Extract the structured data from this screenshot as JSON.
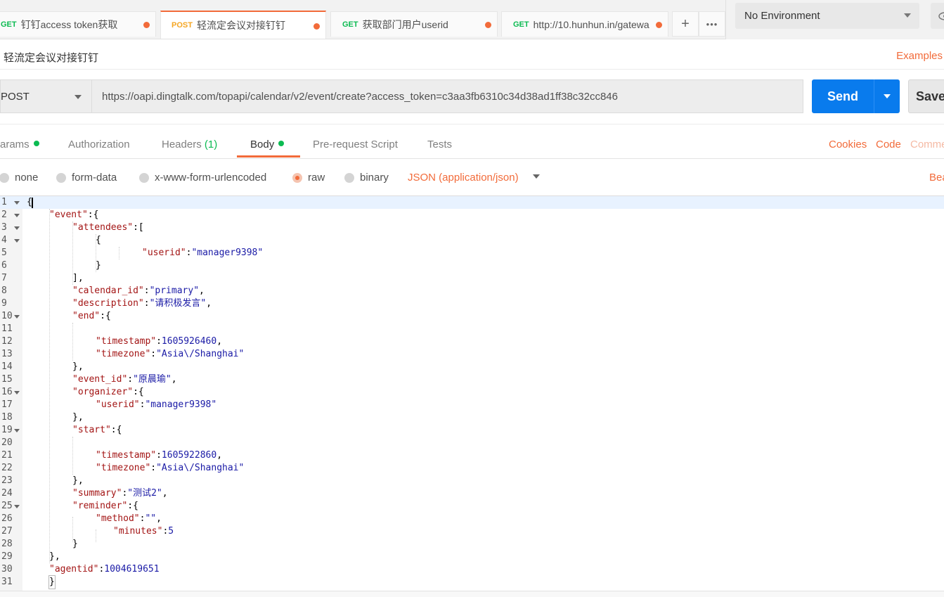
{
  "tabs": [
    {
      "method": "GET",
      "title": "钉钉access token获取"
    },
    {
      "method": "POST",
      "title": "轻流定会议对接钉钉"
    },
    {
      "method": "GET",
      "title": "获取部门用户userid"
    },
    {
      "method": "GET",
      "title": "http://10.hunhun.in/gatewa"
    }
  ],
  "tab_actions": {
    "add": "+",
    "more": "•••"
  },
  "environment": {
    "selected": "No Environment"
  },
  "request": {
    "name": "轻流定会议对接钉钉",
    "examples_label": "Examples",
    "method": "POST",
    "url": "https://oapi.dingtalk.com/topapi/calendar/v2/event/create?access_token=c3aa3fb6310c34d38ad1ff38c32cc846",
    "send_label": "Send",
    "save_label": "Save"
  },
  "request_tabs": {
    "params": "arams",
    "authorization": "Authorization",
    "headers": "Headers",
    "headers_count": "(1)",
    "body": "Body",
    "prerequest": "Pre-request Script",
    "tests": "Tests",
    "cookies": "Cookies",
    "code": "Code",
    "comments": "Comme"
  },
  "body_types": {
    "none": "none",
    "form_data": "form-data",
    "urlencoded": "x-www-form-urlencoded",
    "raw": "raw",
    "binary": "binary",
    "content_type": "JSON (application/json)",
    "beautify": "Bea"
  },
  "colors": {
    "accent": "#f26b3a",
    "primary": "#097bed",
    "get": "#0cbb52",
    "post": "#f5a623"
  },
  "editor": {
    "line_numbers": [
      "1",
      "2",
      "3",
      "4",
      "5",
      "6",
      "7",
      "8",
      "9",
      "10",
      "11",
      "12",
      "13",
      "14",
      "15",
      "16",
      "17",
      "18",
      "19",
      "20",
      "21",
      "22",
      "23",
      "24",
      "25",
      "26",
      "27",
      "28",
      "29",
      "30",
      "31"
    ],
    "code": {
      "l1_brace": "{",
      "l2_key": "\"event\"",
      "l2_rest": ":{",
      "l3_key": "\"attendees\"",
      "l3_rest": ":[",
      "l4": "{",
      "l5_key": "\"userid\"",
      "l5_colon": ":",
      "l5_val": "\"manager9398\"",
      "l6": "}",
      "l7": "],",
      "l8_key": "\"calendar_id\"",
      "l8_colon": ":",
      "l8_val": "\"primary\"",
      "l8_end": ",",
      "l9_key": "\"description\"",
      "l9_colon": ":",
      "l9_val": "\"请积极发言\"",
      "l9_end": ",",
      "l10_key": "\"end\"",
      "l10_rest": ":{",
      "l12_key": "\"timestamp\"",
      "l12_colon": ":",
      "l12_val": "1605926460",
      "l12_end": ",",
      "l13_key": "\"timezone\"",
      "l13_colon": ":",
      "l13_val": "\"Asia\\/Shanghai\"",
      "l14": "},",
      "l15_key": "\"event_id\"",
      "l15_colon": ":",
      "l15_val": "\"原晨瑜\"",
      "l15_end": ",",
      "l16_key": "\"organizer\"",
      "l16_rest": ":{",
      "l17_key": "\"userid\"",
      "l17_colon": ":",
      "l17_val": "\"manager9398\"",
      "l18": "},",
      "l19_key": "\"start\"",
      "l19_rest": ":{",
      "l21_key": "\"timestamp\"",
      "l21_colon": ":",
      "l21_val": "1605922860",
      "l21_end": ",",
      "l22_key": "\"timezone\"",
      "l22_colon": ":",
      "l22_val": "\"Asia\\/Shanghai\"",
      "l23": "},",
      "l24_key": "\"summary\"",
      "l24_colon": ":",
      "l24_val": "\"测试2\"",
      "l24_end": ",",
      "l25_key": "\"reminder\"",
      "l25_rest": ":{",
      "l26_key": "\"method\"",
      "l26_colon": ":",
      "l26_val": "\"\"",
      "l26_end": ",",
      "l27_key": "\"minutes\"",
      "l27_colon": ":",
      "l27_val": "5",
      "l28": "}",
      "l29": "},",
      "l30_key": "\"agentid\"",
      "l30_colon": ":",
      "l30_val": "1004619651",
      "l31": "}"
    }
  }
}
